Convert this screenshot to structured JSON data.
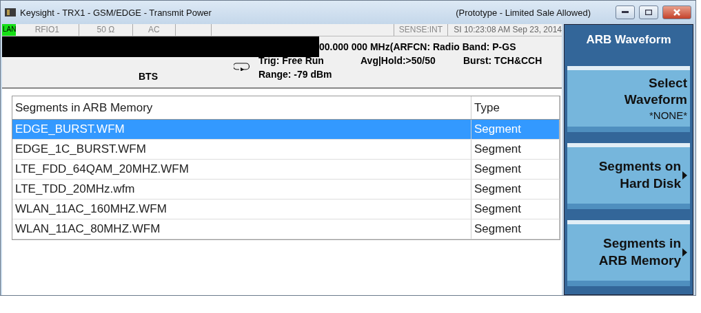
{
  "window": {
    "title": "Keysight - TRX1 - GSM/EDGE - Transmit Power",
    "notice": "(Prototype - Limited Sale Allowed)"
  },
  "status_bar": {
    "lan": "LAN",
    "fields": [
      "RFIO1",
      "50 Ω",
      "AC",
      "SENSE:INT"
    ],
    "datetime": "SI 10:23:08 AM Sep 23, 2014"
  },
  "settings": {
    "frequency": "00.000 000 MHz(ARFCN: Radio Band: P-GS",
    "trig": "Trig: Free Run",
    "avg": "Avg|Hold:>50/50",
    "burst": "Burst: TCH&CCH",
    "mode": "BTS",
    "range": "Range: -79 dBm"
  },
  "table": {
    "columns": [
      "Segments in ARB Memory",
      "Type"
    ],
    "rows": [
      {
        "name": "EDGE_BURST.WFM",
        "type": "Segment",
        "selected": true
      },
      {
        "name": "EDGE_1C_BURST.WFM",
        "type": "Segment",
        "selected": false
      },
      {
        "name": "LTE_FDD_64QAM_20MHZ.WFM",
        "type": "Segment",
        "selected": false
      },
      {
        "name": "LTE_TDD_20MHz.wfm",
        "type": "Segment",
        "selected": false
      },
      {
        "name": "WLAN_11AC_160MHZ.WFM",
        "type": "Segment",
        "selected": false
      },
      {
        "name": "WLAN_11AC_80MHZ.WFM",
        "type": "Segment",
        "selected": false
      }
    ]
  },
  "softkeys": {
    "title": "ARB Waveform",
    "keys": [
      {
        "kind": "value",
        "lines": [
          "Select",
          "Waveform"
        ],
        "value": "*NONE*"
      },
      {
        "kind": "submenu",
        "lines": [
          "Segments on",
          "Hard Disk"
        ]
      },
      {
        "kind": "submenu",
        "lines": [
          "Segments in",
          "ARB Memory"
        ]
      }
    ]
  }
}
